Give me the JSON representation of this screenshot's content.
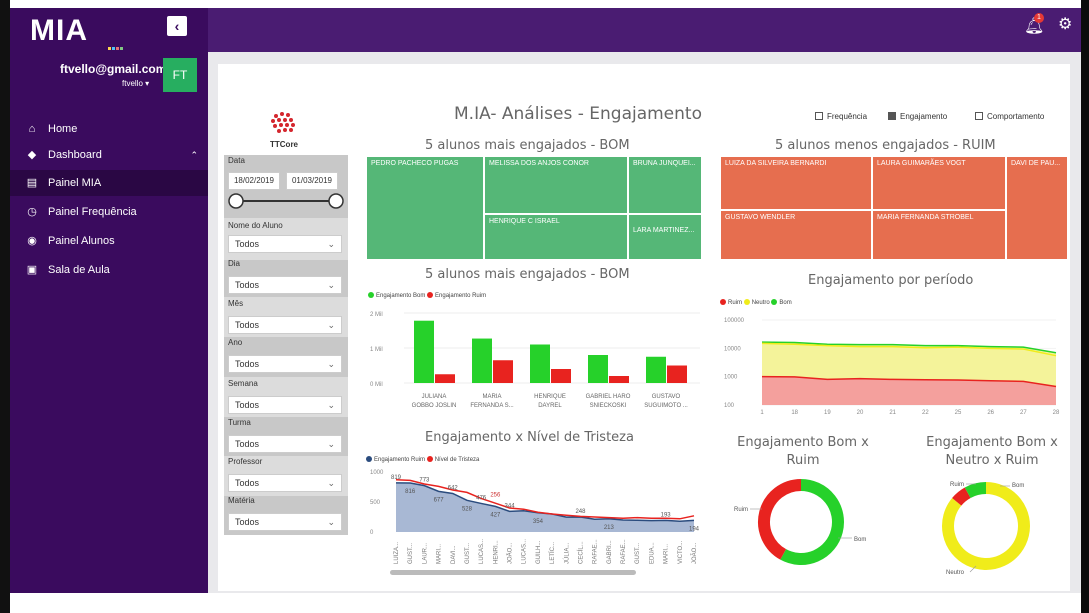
{
  "app": {
    "logo": "MIA",
    "logo_suffix": "..."
  },
  "user": {
    "email": "ftvello@gmail.com",
    "username": "ftvello",
    "initials": "FT"
  },
  "nav": [
    {
      "label": "Home",
      "icon": "home-icon",
      "glyph": "⌂"
    },
    {
      "label": "Dashboard",
      "icon": "tag-icon",
      "glyph": "◆"
    },
    {
      "label": "Painel MIA",
      "icon": "document-icon",
      "glyph": "▤"
    },
    {
      "label": "Painel Frequência",
      "icon": "stopwatch-icon",
      "glyph": "◷"
    },
    {
      "label": "Painel Alunos",
      "icon": "eye-icon",
      "glyph": "◉"
    },
    {
      "label": "Sala de Aula",
      "icon": "classroom-icon",
      "glyph": "▣"
    }
  ],
  "topbar": {
    "notification_count": "1"
  },
  "report": {
    "title": "M.IA- Análises - Engajamento",
    "brand": "TTCore",
    "toggles": [
      {
        "label": "Frequência",
        "checked": false
      },
      {
        "label": "Engajamento",
        "checked": true
      },
      {
        "label": "Comportamento",
        "checked": false
      }
    ]
  },
  "filters": {
    "data_label": "Data",
    "date_from": "18/02/2019",
    "date_to": "01/03/2019",
    "items": [
      {
        "label": "Nome do Aluno",
        "value": "Todos"
      },
      {
        "label": "Dia",
        "value": "Todos"
      },
      {
        "label": "Mês",
        "value": "Todos"
      },
      {
        "label": "Ano",
        "value": "Todos"
      },
      {
        "label": "Semana",
        "value": "Todos"
      },
      {
        "label": "Turma",
        "value": "Todos"
      },
      {
        "label": "Professor",
        "value": "Todos"
      },
      {
        "label": "Matéria",
        "value": "Todos"
      }
    ]
  },
  "treemap_good": {
    "title": "5 alunos  mais engajados - BOM",
    "cells": [
      "PEDRO PACHECO PUGAS",
      "MELISSA DOS ANJOS CONOR",
      "BRUNA JUNQUEI...",
      "HENRIQUE C ISRAEL",
      "LARA MARTINEZ..."
    ]
  },
  "treemap_bad": {
    "title": "5 alunos  menos engajados - RUIM",
    "cells": [
      "LUIZA DA SILVEIRA BERNARDI",
      "LAURA GUIMARÃES VOGT",
      "DAVI DE PAU...",
      "GUSTAVO WENDLER",
      "MARIA FERNANDA STROBEL"
    ]
  },
  "colors": {
    "green": "#26d12a",
    "red": "#e8231f",
    "yellow": "#f0ec1a",
    "blue": "#2b4c7e"
  },
  "chart_data": [
    {
      "type": "bar",
      "title": "5 alunos  mais engajados - BOM",
      "categories": [
        "JULIANA GOBBO JOSLIN",
        "MARIA FERNANDA S...",
        "HENRIQUE DAYREL",
        "GABRIEL HARO SNIECKOSKI",
        "GUSTAVO SUGUIMOTO ..."
      ],
      "category_lines": [
        [
          "JULIANA",
          "GOBBO JOSLIN"
        ],
        [
          "MARIA",
          "FERNANDA S..."
        ],
        [
          "HENRIQUE",
          "DAYREL"
        ],
        [
          "GABRIEL HARO",
          "SNIECKOSKI"
        ],
        [
          "GUSTAVO",
          "SUGUIMOTO ..."
        ]
      ],
      "series": [
        {
          "name": "Engajamento Bom",
          "values": [
            1.78,
            1.27,
            1.1,
            0.8,
            0.75
          ]
        },
        {
          "name": "Engajamento Ruim",
          "values": [
            0.25,
            0.65,
            0.4,
            0.2,
            0.5
          ]
        }
      ],
      "yticks": [
        "0 Mil",
        "1 Mil",
        "2 Mil"
      ],
      "ylim": [
        0,
        2
      ]
    },
    {
      "type": "area",
      "title": "Engajamento por período",
      "scale": "log",
      "x": [
        "1",
        "18",
        "19",
        "20",
        "21",
        "22",
        "25",
        "26",
        "27",
        "28"
      ],
      "yticks": [
        "100",
        "1000",
        "10000",
        "100000"
      ],
      "series": [
        {
          "name": "Ruim",
          "values": [
            1000,
            980,
            800,
            850,
            800,
            780,
            760,
            720,
            680,
            450
          ]
        },
        {
          "name": "Neutro",
          "values": [
            15000,
            14000,
            12500,
            11500,
            11500,
            10500,
            11000,
            10000,
            9500,
            5500
          ]
        },
        {
          "name": "Bom",
          "values": [
            16500,
            16000,
            14000,
            13500,
            13500,
            12500,
            12500,
            11500,
            11000,
            7000
          ]
        }
      ]
    },
    {
      "type": "area",
      "title": "Engajamento  x Nível de Tristeza",
      "x": [
        "LUIZA...",
        "GUST...",
        "LAUR...",
        "MARI...",
        "DAVI...",
        "GUST...",
        "LUCAS...",
        "HENRI...",
        "JOÃO...",
        "LUCAS...",
        "GUILH...",
        "LETÍC...",
        "JÚLIA...",
        "CECÍL...",
        "RAFAE...",
        "GABRI...",
        "RAFAE...",
        "GUST...",
        "EDUA...",
        "MARI...",
        "VICTO...",
        "JOÃO..."
      ],
      "series": [
        {
          "name": "Engajamento Ruim",
          "values": [
            819,
            816,
            773,
            677,
            642,
            528,
            476,
            427,
            344,
            354,
            320,
            300,
            248,
            250,
            212,
            220,
            200,
            195,
            190,
            193,
            180,
            194
          ]
        },
        {
          "name": "Nível de Tristeza",
          "values": [
            870,
            860,
            800,
            760,
            700,
            660,
            560,
            480,
            400,
            380,
            330,
            300,
            280,
            260,
            250,
            240,
            230,
            240,
            230,
            230,
            220,
            270
          ]
        }
      ],
      "labels_ruim": [
        "819",
        "816",
        "773",
        "677",
        "642",
        "528",
        "476",
        "427",
        "344",
        "354",
        "248",
        "213",
        "193",
        "194"
      ],
      "label_tristeza": "256",
      "yticks": [
        "0",
        "500",
        "1000"
      ],
      "ylim": [
        0,
        1000
      ]
    },
    {
      "type": "pie",
      "title": "Engajamento Bom x Ruim",
      "slices": [
        {
          "label": "Bom",
          "value": 58
        },
        {
          "label": "Ruim",
          "value": 42
        }
      ]
    },
    {
      "type": "pie",
      "title": "Engajamento Bom x Neutro x Ruim",
      "slices": [
        {
          "label": "Neutro",
          "value": 86
        },
        {
          "label": "Ruim",
          "value": 6
        },
        {
          "label": "Bom",
          "value": 8
        }
      ]
    }
  ]
}
